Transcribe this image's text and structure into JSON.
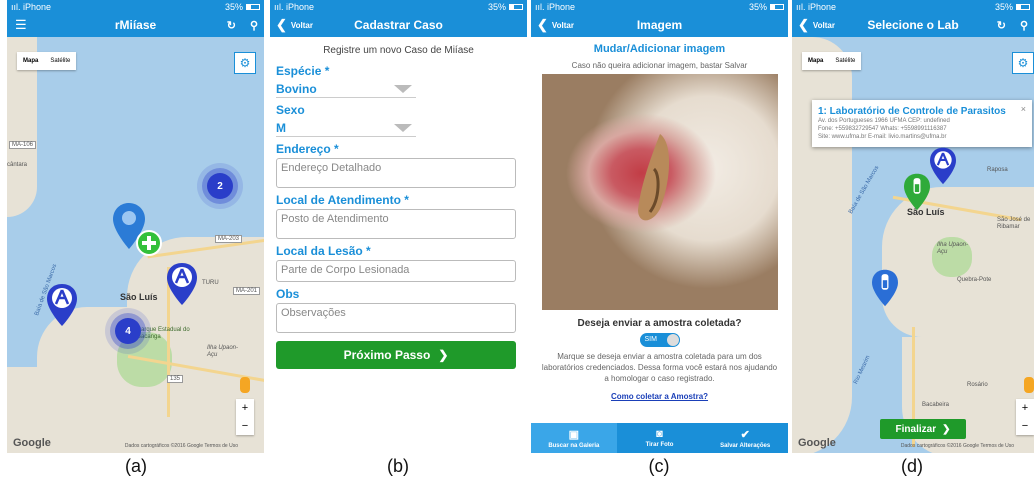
{
  "status": {
    "carrier": "ııl. iPhone",
    "battery": "35%"
  },
  "panel_a": {
    "caption": "(a)",
    "nav_title": "rMiíase",
    "map_mode_map": "Mapa",
    "map_mode_satellite": "Satélite",
    "city_label": "São Luís",
    "park_label": "Parque Estadual do Bacanga",
    "area_label": "Ilha Upaon-Açu",
    "cluster_1": "2",
    "cluster_2": "4",
    "road_1": "MA-106",
    "road_2": "MA-203",
    "road_3": "MA-201",
    "place_1": "cântara",
    "place_2": "Baía de São Marcos",
    "place_3": "TURU",
    "road_4": "135",
    "google": "Google",
    "attribution": "Dados cartográficos ©2016 Google   Termos de Uso"
  },
  "panel_b": {
    "caption": "(b)",
    "back": "Voltar",
    "nav_title": "Cadastrar Caso",
    "subtitle": "Registre um novo Caso de Miíase",
    "species_label": "Espécie *",
    "species_value": "Bovino",
    "sex_label": "Sexo",
    "sex_value": "M",
    "address_label": "Endereço *",
    "address_placeholder": "Endereço Detalhado",
    "service_label": "Local de Atendimento *",
    "service_placeholder": "Posto de Atendimento",
    "lesion_label": "Local da Lesão *",
    "lesion_placeholder": "Parte de Corpo Lesionada",
    "obs_label": "Obs",
    "obs_placeholder": "Observações",
    "next_button": "Próximo Passo"
  },
  "panel_c": {
    "caption": "(c)",
    "back": "Voltar",
    "nav_title": "Imagem",
    "change_link": "Mudar/Adicionar imagem",
    "note": "Caso não queira adicionar imagem, bastar Salvar",
    "question": "Deseja enviar a amostra coletada?",
    "toggle": "SIM",
    "description": "Marque se deseja enviar a amostra coletada para um dos laboratórios credenciados. Dessa forma você estará nos ajudando a homologar o caso registrado.",
    "help_link": "Como coletar a Amostra?",
    "tab_gallery": "Buscar na Galeria",
    "tab_photo": "Tirar Foto",
    "tab_save": "Salvar Alterações"
  },
  "panel_d": {
    "caption": "(d)",
    "back": "Voltar",
    "nav_title": "Selecione o Lab",
    "map_mode_map": "Mapa",
    "map_mode_satellite": "Satélite",
    "lab_name": "1: Laboratório de Controle de Parasitos",
    "lab_address": "Av. dos Portugueses 1966 UFMA CEP: undefined",
    "lab_phone": "Fone: +559832729547 Whats: +5598991116387",
    "lab_site": "Site: www.ufma.br E-mail: livio.martins@ufma.br",
    "city_label": "São Luís",
    "area_label": "Ilha Upaon-Açu",
    "place_1": "Raposa",
    "place_2": "São José de Ribamar",
    "place_3": "Quebra-Pote",
    "place_4": "Rosário",
    "place_5": "Bacabeira",
    "place_6": "Baía de São Marcos",
    "place_7": "Rio Mearim",
    "finish_button": "Finalizar",
    "google": "Google",
    "attribution": "Dados cartográficos ©2016 Google   Termos de Uso"
  }
}
